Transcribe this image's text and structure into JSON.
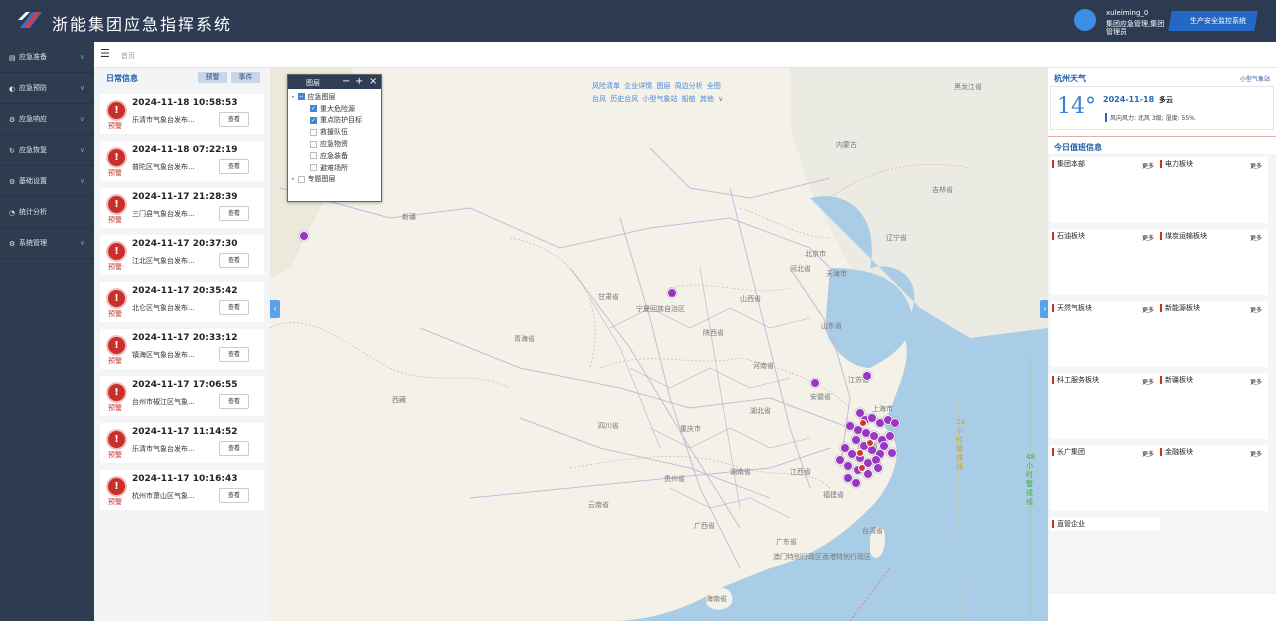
{
  "header": {
    "title": "浙能集团应急指挥系统",
    "user_name": "xuleiming_0",
    "user_role": "集团应急管理,集团管理员",
    "prod_button": "生产安全监控系统"
  },
  "sidebar": {
    "items": [
      {
        "label": "应急准备",
        "icon": "clipboard-icon"
      },
      {
        "label": "应急预防",
        "icon": "shield-icon"
      },
      {
        "label": "应急响应",
        "icon": "gear-icon"
      },
      {
        "label": "应急恢复",
        "icon": "refresh-icon"
      },
      {
        "label": "基础设置",
        "icon": "settings-icon"
      },
      {
        "label": "统计分析",
        "icon": "chart-icon"
      },
      {
        "label": "系统管理",
        "icon": "system-icon"
      }
    ]
  },
  "breadcrumb": {
    "home": "首页"
  },
  "daily": {
    "title": "日常信息",
    "tab_warning": "预警",
    "tab_event": "事件",
    "view_label": "查看",
    "tag": "预警",
    "alerts": [
      {
        "time": "2024-11-18 10:58:53",
        "source": "乐清市气象台发布..."
      },
      {
        "time": "2024-11-18 07:22:19",
        "source": "普陀区气象台发布..."
      },
      {
        "time": "2024-11-17 21:28:39",
        "source": "三门县气象台发布..."
      },
      {
        "time": "2024-11-17 20:37:30",
        "source": "江北区气象台发布..."
      },
      {
        "time": "2024-11-17 20:35:42",
        "source": "北仑区气象台发布..."
      },
      {
        "time": "2024-11-17 20:33:12",
        "source": "镇海区气象台发布..."
      },
      {
        "time": "2024-11-17 17:06:55",
        "source": "台州市椒江区气象..."
      },
      {
        "time": "2024-11-17 11:14:52",
        "source": "乐清市气象台发布..."
      },
      {
        "time": "2024-11-17 10:16:43",
        "source": "杭州市萧山区气象..."
      }
    ]
  },
  "layers": {
    "title": "图层",
    "items": [
      {
        "label": "应急图层",
        "checked": "partial",
        "level": 0
      },
      {
        "label": "重大危险源",
        "checked": true,
        "level": 1
      },
      {
        "label": "重点防护目标",
        "checked": true,
        "level": 1
      },
      {
        "label": "救援队伍",
        "checked": false,
        "level": 1
      },
      {
        "label": "应急物资",
        "checked": false,
        "level": 1
      },
      {
        "label": "应急装备",
        "checked": false,
        "level": 1
      },
      {
        "label": "避难场所",
        "checked": false,
        "level": 1
      },
      {
        "label": "专题图层",
        "checked": false,
        "level": 0
      }
    ]
  },
  "map_tools": {
    "row1": "风险清单  企业详情  图层  周边分析  全图",
    "row2": "台风  历史台风  小型气象站  船舶  其他 ∨"
  },
  "map_labels": [
    "新疆",
    "西藏",
    "青海省",
    "甘肃省",
    "四川省",
    "内蒙古",
    "宁夏回族自治区",
    "陕西省",
    "山西省",
    "河北省",
    "北京市",
    "天津市",
    "辽宁省",
    "吉林省",
    "黑龙江省",
    "山东省",
    "河南省",
    "江苏省",
    "安徽省",
    "上海市",
    "湖北省",
    "重庆市",
    "浙江省",
    "贵州省",
    "湖南省",
    "江西省",
    "云南省",
    "广西省",
    "广东省",
    "福建省",
    "台湾省",
    "海南省",
    "澳门特别行政区香港特别行政区"
  ],
  "sea_lines": {
    "line1": "24小时警戒线",
    "line2": "48小时警戒线"
  },
  "weather": {
    "city": "杭州天气",
    "link": "小型气象站",
    "temp": "14°",
    "date": "2024-11-18",
    "condition": "多云",
    "detail": "风向风力: 北风 3级; 湿度: 55%"
  },
  "duty": {
    "title": "今日值班信息",
    "more": "更多",
    "sections": [
      "集团本部",
      "电力板块",
      "石油板块",
      "煤炭运输板块",
      "天然气板块",
      "新能源板块",
      "科工服务板块",
      "新疆板块",
      "长广集团",
      "金融板块",
      "直管企业"
    ]
  }
}
